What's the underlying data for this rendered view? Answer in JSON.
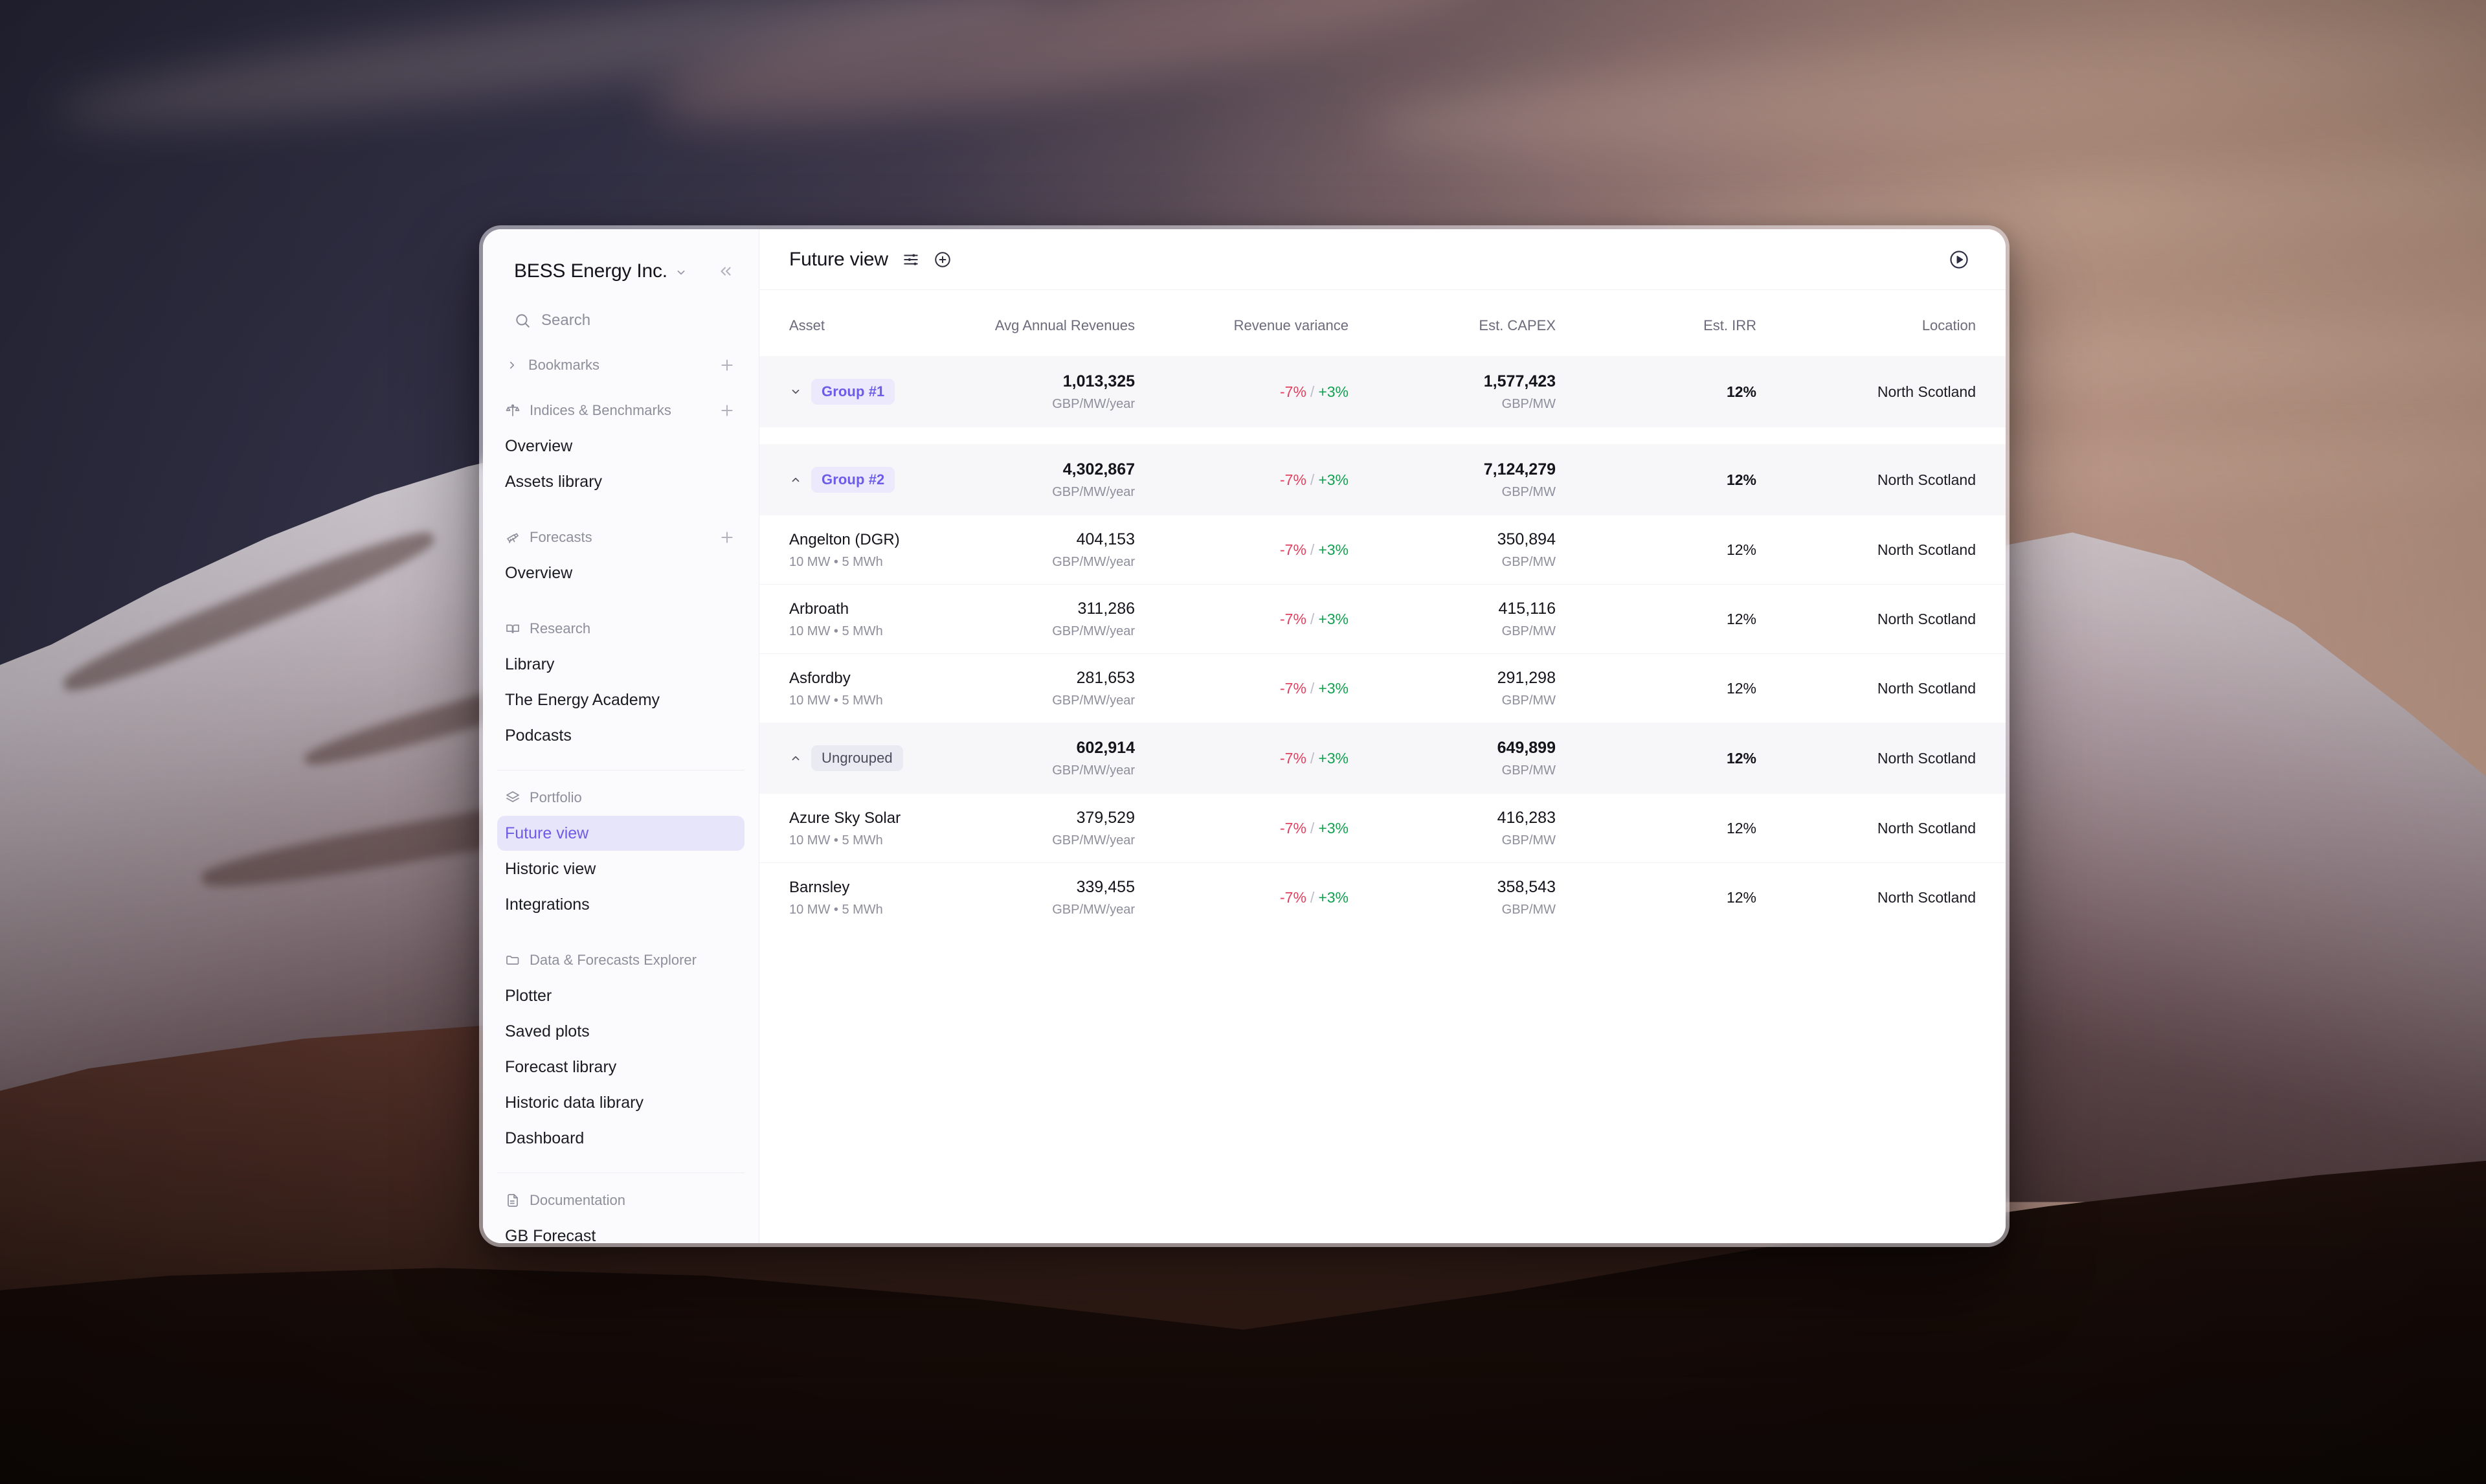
{
  "sidebar": {
    "org": {
      "name": "BESS Energy Inc.",
      "caret_icon": "chevron-down-icon",
      "collapse_icon": "chevrons-left-icon"
    },
    "search": {
      "label": "Search",
      "icon": "search-icon"
    },
    "sections": [
      {
        "label": "Bookmarks",
        "icon": "chevron-right-icon",
        "action": "+",
        "items": []
      },
      {
        "label": "Indices & Benchmarks",
        "icon": "scale-icon",
        "action": "+",
        "items": [
          {
            "label": "Overview",
            "active": false
          },
          {
            "label": "Assets library",
            "active": false
          }
        ]
      },
      {
        "label": "Forecasts",
        "icon": "telescope-icon",
        "action": "+",
        "items": [
          {
            "label": "Overview",
            "active": false
          }
        ]
      },
      {
        "label": "Research",
        "icon": "book-open-icon",
        "action": "",
        "items": [
          {
            "label": "Library",
            "active": false
          },
          {
            "label": "The Energy Academy",
            "active": false
          },
          {
            "label": "Podcasts",
            "active": false
          }
        ]
      },
      {
        "label": "Portfolio",
        "icon": "layers-icon",
        "action": "",
        "items": [
          {
            "label": "Future view",
            "active": true
          },
          {
            "label": "Historic view",
            "active": false
          },
          {
            "label": "Integrations",
            "active": false
          }
        ]
      },
      {
        "label": "Data & Forecasts Explorer",
        "icon": "folder-icon",
        "action": "",
        "items": [
          {
            "label": "Plotter",
            "active": false
          },
          {
            "label": "Saved plots",
            "active": false
          },
          {
            "label": "Forecast library",
            "active": false
          },
          {
            "label": "Historic data library",
            "active": false
          },
          {
            "label": "Dashboard",
            "active": false
          }
        ]
      },
      {
        "label": "Documentation",
        "icon": "file-text-icon",
        "action": "",
        "items": [
          {
            "label": "GB Forecast",
            "active": false
          }
        ]
      }
    ]
  },
  "main": {
    "title": "Future view",
    "settings_icon": "sliders-icon",
    "add_icon": "plus-circle-icon",
    "play_icon": "play-circle-icon"
  },
  "table": {
    "columns": [
      "Asset",
      "Avg Annual Revenues",
      "Revenue variance",
      "Est. CAPEX",
      "Est. IRR",
      "Location"
    ],
    "units": {
      "revenue": "GBP/MW/year",
      "capex": "GBP/MW"
    },
    "rows": [
      {
        "kind": "group",
        "name": "Group #1",
        "expanded": false,
        "chevron": "⌄",
        "revenue": "1,013,325",
        "revenue_unit": "GBP/MW/year",
        "variance_neg": "-7%",
        "variance_pos": "+3%",
        "capex": "1,577,423",
        "capex_unit": "GBP/MW",
        "irr": "12%",
        "location": "North Scotland"
      },
      {
        "kind": "group",
        "name": "Group #2",
        "expanded": true,
        "chevron": "˄",
        "revenue": "4,302,867",
        "revenue_unit": "GBP/MW/year",
        "variance_neg": "-7%",
        "variance_pos": "+3%",
        "capex": "7,124,279",
        "capex_unit": "GBP/MW",
        "irr": "12%",
        "location": "North Scotland"
      },
      {
        "kind": "asset",
        "name": "Angelton (DGR)",
        "spec": "10 MW • 5 MWh",
        "revenue": "404,153",
        "revenue_unit": "GBP/MW/year",
        "variance_neg": "-7%",
        "variance_pos": "+3%",
        "capex": "350,894",
        "capex_unit": "GBP/MW",
        "irr": "12%",
        "location": "North Scotland"
      },
      {
        "kind": "asset",
        "name": "Arbroath",
        "spec": "10 MW • 5 MWh",
        "revenue": "311,286",
        "revenue_unit": "GBP/MW/year",
        "variance_neg": "-7%",
        "variance_pos": "+3%",
        "capex": "415,116",
        "capex_unit": "GBP/MW",
        "irr": "12%",
        "location": "North Scotland"
      },
      {
        "kind": "asset",
        "name": "Asfordby",
        "spec": "10 MW • 5 MWh",
        "revenue": "281,653",
        "revenue_unit": "GBP/MW/year",
        "variance_neg": "-7%",
        "variance_pos": "+3%",
        "capex": "291,298",
        "capex_unit": "GBP/MW",
        "irr": "12%",
        "location": "North Scotland"
      },
      {
        "kind": "group",
        "name": "Ungrouped",
        "expanded": true,
        "chevron": "˄",
        "revenue": "602,914",
        "revenue_unit": "GBP/MW/year",
        "variance_neg": "-7%",
        "variance_pos": "+3%",
        "capex": "649,899",
        "capex_unit": "GBP/MW",
        "irr": "12%",
        "location": "North Scotland"
      },
      {
        "kind": "asset",
        "name": "Azure Sky Solar",
        "spec": "10 MW • 5 MWh",
        "revenue": "379,529",
        "revenue_unit": "GBP/MW/year",
        "variance_neg": "-7%",
        "variance_pos": "+3%",
        "capex": "416,283",
        "capex_unit": "GBP/MW",
        "irr": "12%",
        "location": "North Scotland"
      },
      {
        "kind": "asset",
        "name": "Barnsley",
        "spec": "10 MW • 5 MWh",
        "revenue": "339,455",
        "revenue_unit": "GBP/MW/year",
        "variance_neg": "-7%",
        "variance_pos": "+3%",
        "capex": "358,543",
        "capex_unit": "GBP/MW",
        "irr": "12%",
        "location": "North Scotland"
      }
    ]
  },
  "colors": {
    "accent": "#6c5ce7",
    "accent_bg": "#e7e5fa",
    "badge_bg": "#ece9fd",
    "negative": "#e0415f",
    "positive": "#12a150",
    "text": "#14141c",
    "muted": "#8e8e9c",
    "group_row_bg": "#f7f7fa"
  }
}
